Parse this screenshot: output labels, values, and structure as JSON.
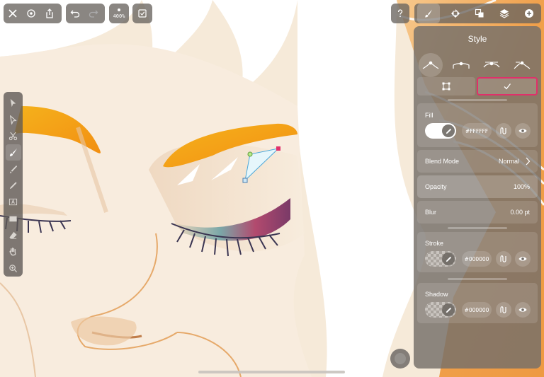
{
  "top_toolbar": {
    "zoom_label": "400%"
  },
  "inspector": {
    "title": "Style",
    "fill": {
      "label": "Fill",
      "hex": "#FFFFFF",
      "color": "#FFFFFF"
    },
    "blend_mode": {
      "label": "Blend Mode",
      "value": "Normal"
    },
    "opacity": {
      "label": "Opacity",
      "value": "100%"
    },
    "blur": {
      "label": "Blur",
      "value": "0.00 pt"
    },
    "stroke": {
      "label": "Stroke",
      "hex": "#000000"
    },
    "shadow": {
      "label": "Shadow",
      "hex": "#000000"
    }
  },
  "colors": {
    "accent_highlight": "#e0306a",
    "panel_bg": "#76706a",
    "eyeshadow_orange": "#f5a623"
  }
}
